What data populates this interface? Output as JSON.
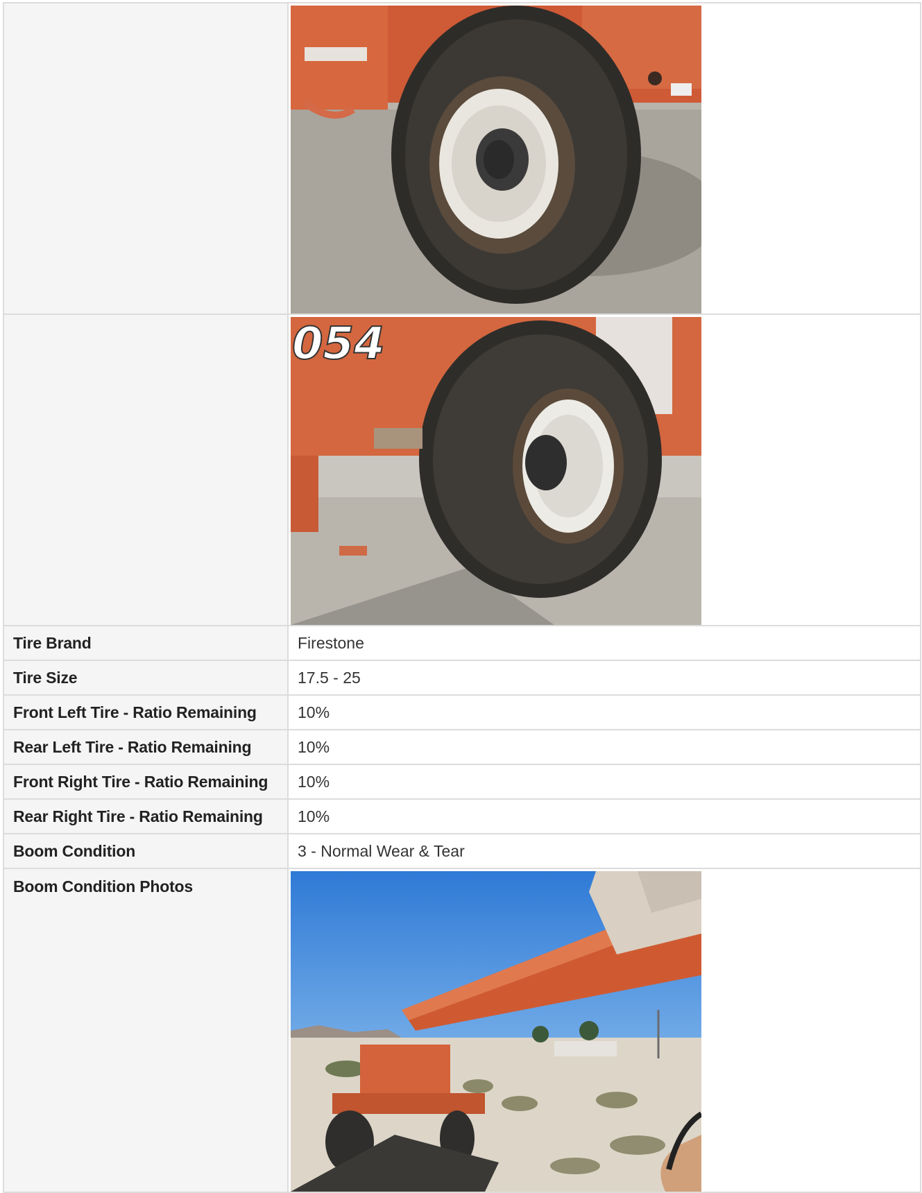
{
  "rows": [
    {
      "label": "Tire Brand",
      "value": "Firestone"
    },
    {
      "label": "Tire Size",
      "value": "17.5 - 25"
    },
    {
      "label": "Front Left Tire - Ratio Remaining",
      "value": "10%"
    },
    {
      "label": "Rear Left Tire - Ratio Remaining",
      "value": "10%"
    },
    {
      "label": "Front Right Tire - Ratio Remaining",
      "value": "10%"
    },
    {
      "label": "Rear Right Tire - Ratio Remaining",
      "value": "10%"
    },
    {
      "label": "Boom Condition",
      "value": "3 - Normal Wear & Tear"
    },
    {
      "label": "Boom Condition Photos",
      "value": ""
    }
  ],
  "photo_labels": {
    "decal_photo2": "054"
  },
  "colors": {
    "machine_orange": "#d9603a",
    "sky_blue": "#3b82d6",
    "sand": "#d8d2c6",
    "label_bg": "#f5f5f5",
    "border": "#dcdcdc"
  }
}
